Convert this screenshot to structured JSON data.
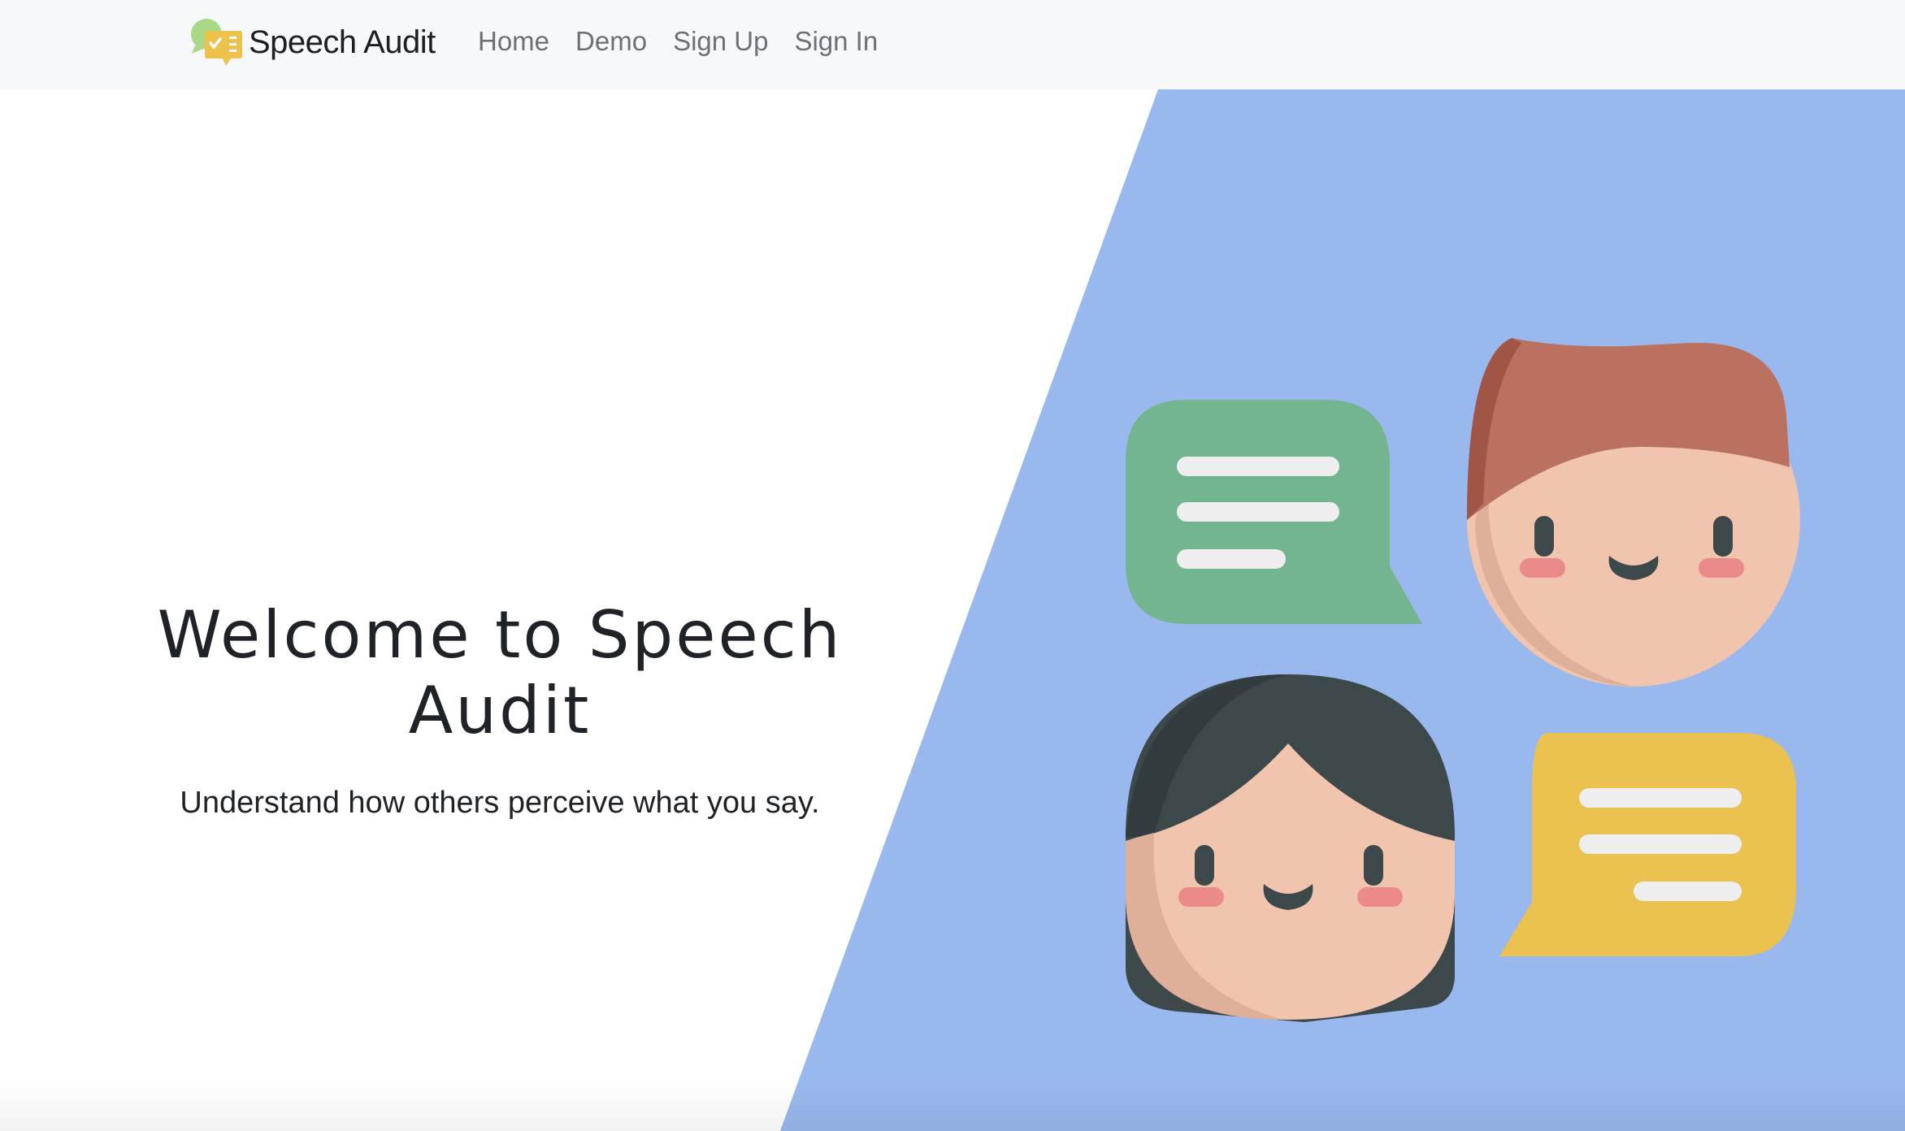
{
  "navbar": {
    "brand": {
      "name": "Speech Audit",
      "logo_icon": "speech-bubble-checklist-icon"
    },
    "links": [
      {
        "label": "Home"
      },
      {
        "label": "Demo"
      },
      {
        "label": "Sign Up"
      },
      {
        "label": "Sign In"
      }
    ]
  },
  "hero": {
    "title": "Welcome to Speech Audit",
    "subtitle": "Understand how others perceive what you say.",
    "illustration_icons": [
      "chat-bubble-icon",
      "boy-face-icon",
      "girl-face-icon",
      "chat-bubble-icon"
    ]
  },
  "colors": {
    "navbar_background": "#f7f8f9",
    "hero_accent_blue": "#99b8ed",
    "green_bubble": "#73b590",
    "yellow_bubble": "#ebc24f",
    "skin": "#f1c4ae",
    "hair_red": "#bb7160",
    "hair_dark": "#3d484a",
    "cheek": "#ea8b8a"
  }
}
